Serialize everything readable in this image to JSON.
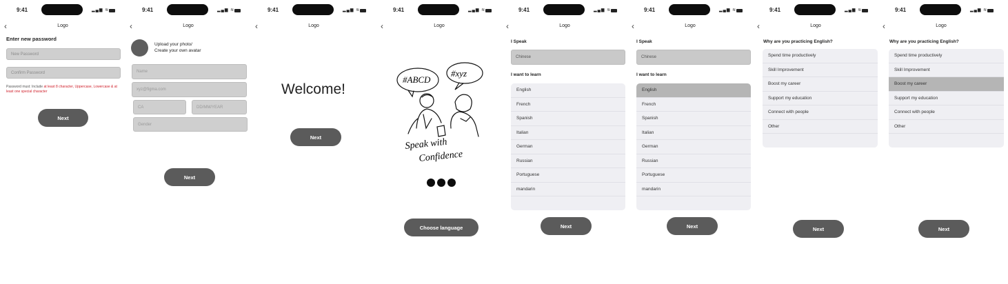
{
  "status": {
    "time": "9:41"
  },
  "nav": {
    "logo": "Logo",
    "back": "‹"
  },
  "s1": {
    "title": "Enter new password",
    "new_password_placeholder": "New Password",
    "confirm_password_placeholder": "Confirm Password",
    "hint_prefix": "Password must: Include ",
    "hint_red": "at least 8 character, Uppercase, Lowercase & at least one special character",
    "next": "Next"
  },
  "s2": {
    "upload_line1": "Upload your photo/",
    "upload_line2": "Create your own avatar",
    "name_placeholder": "Name",
    "email_placeholder": "xyz@figma.com",
    "country_placeholder": "CA",
    "dob_placeholder": "DD/MM/YEAR",
    "gender_placeholder": "Gender",
    "next": "Next"
  },
  "s3": {
    "welcome": "Welcome!",
    "next": "Next"
  },
  "s4": {
    "bubble1": "#ABCD",
    "bubble2": "#xyz",
    "caption1": "Speak with",
    "caption2": "Confidence",
    "cta": "Choose language"
  },
  "s5": {
    "speak_label": "I Speak",
    "speak_value": "Chinese",
    "learn_label": "I want to learn",
    "languages": [
      "English",
      "French",
      "Spanish",
      "Italian",
      "German",
      "Russian",
      "Portuguese",
      "mandarin"
    ],
    "next": "Next"
  },
  "s6": {
    "speak_label": "I Speak",
    "speak_value": "Chinese",
    "learn_label": "I want to learn",
    "languages": [
      "English",
      "French",
      "Spanish",
      "Italian",
      "German",
      "Russian",
      "Portuguese",
      "mandarin"
    ],
    "selected": "English",
    "next": "Next"
  },
  "s7": {
    "question": "Why are you practicing English?",
    "reasons": [
      "Spend time productively",
      "Skill Improvement",
      "Boost my career",
      "Support my education",
      "Connect with people",
      "Other"
    ],
    "next": "Next"
  },
  "s8": {
    "question": "Why are you practicing English?",
    "reasons": [
      "Spend time productively",
      "Skill Improvement",
      "Boost my career",
      "Support my education",
      "Connect with people",
      "Other"
    ],
    "selected": "Boost my career",
    "next": "Next"
  },
  "colors": {
    "button": "#5b5b5b",
    "field": "#cfcfcf",
    "list_bg": "#efeff3",
    "selected_row": "#b5b5b5",
    "hint_red": "#d0222d"
  }
}
